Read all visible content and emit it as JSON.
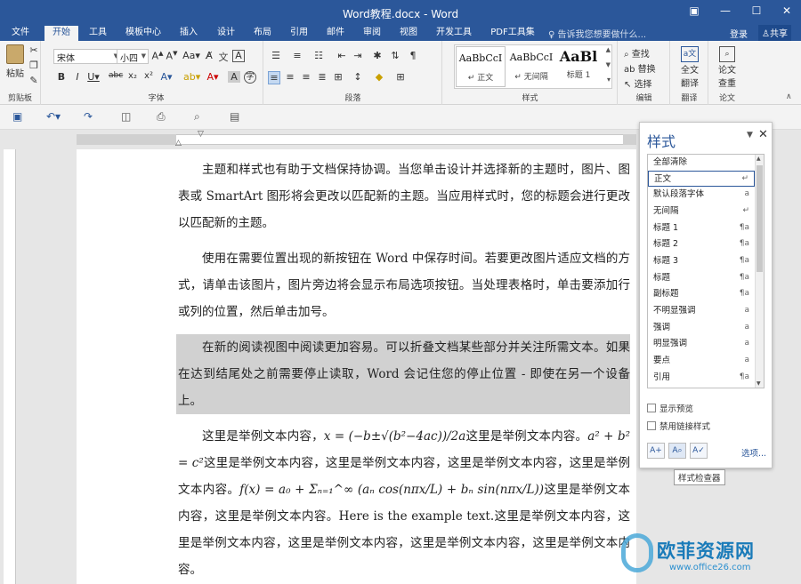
{
  "window": {
    "title": "Word教程.docx - Word",
    "controls": {
      "ribbon_display": "▣",
      "minimize": "—",
      "maximize": "☐",
      "close": "✕"
    }
  },
  "tabs": [
    "文件",
    "开始",
    "工具",
    "模板中心",
    "插入",
    "设计",
    "布局",
    "引用",
    "邮件",
    "审阅",
    "视图",
    "开发工具",
    "PDF工具集"
  ],
  "active_tab": "开始",
  "tellme": "告诉我您想要做什么...",
  "account": {
    "login": "登录",
    "share": "共享"
  },
  "ribbon": {
    "clipboard": {
      "label": "剪贴板",
      "paste": "粘贴"
    },
    "font": {
      "label": "字体",
      "font_name": "宋体",
      "font_size": "小四"
    },
    "paragraph": {
      "label": "段落"
    },
    "styles": {
      "label": "样式",
      "items": [
        {
          "preview": "AaBbCcI",
          "name": "↵ 正文"
        },
        {
          "preview": "AaBbCcI",
          "name": "↵ 无间隔"
        },
        {
          "preview": "AaBl",
          "name": "标题 1"
        }
      ]
    },
    "editing": {
      "label": "编辑",
      "find": "查找",
      "replace": "替换",
      "select": "选择"
    },
    "translate": {
      "label": "翻译",
      "full_text": "全文",
      "translate_btn": "翻译"
    },
    "paper": {
      "label": "论文",
      "check1": "论文",
      "check2": "查重"
    }
  },
  "document": {
    "paragraphs": [
      "主题和样式也有助于文档保持协调。当您单击设计并选择新的主题时，图片、图表或 SmartArt 图形将会更改以匹配新的主题。当应用样式时，您的标题会进行更改以匹配新的主题。",
      "使用在需要位置出现的新按钮在 Word 中保存时间。若要更改图片适应文档的方式，请单击该图片，图片旁边将会显示布局选项按钮。当处理表格时，单击要添加行或列的位置，然后单击加号。",
      "在新的阅读视图中阅读更加容易。可以折叠文档某些部分并关注所需文本。如果在达到结尾处之前需要停止读取，Word 会记住您的停止位置 - 即使在另一个设备上。"
    ],
    "formula_para": {
      "t1": "这里是举例文本内容，",
      "f1": "x = (−b±√(b²−4ac))/2a",
      "t2": "这里是举例文本内容。",
      "f2": "a² + b² = c²",
      "t3": "这里是举例文本内容，这里是举例文本内容，这里是举例文本内容，这里是举例文本内容。",
      "f3": "f(x) = a₀ + Σₙ₌₁^∞ (aₙ cos(nπx/L) + bₙ sin(nπx/L))",
      "t4": "这里是举例文本内容，这里是举例文本内容。Here is the example text.这里是举例文本内容，这里是举例文本内容，这里是举例文本内容，这里是举例文本内容，这里是举例文本内容。"
    }
  },
  "styles_pane": {
    "title": "样式",
    "items": [
      {
        "name": "全部清除",
        "symbol": ""
      },
      {
        "name": "正文",
        "symbol": "↵"
      },
      {
        "name": "默认段落字体",
        "symbol": "a"
      },
      {
        "name": "无间隔",
        "symbol": "↵"
      },
      {
        "name": "标题 1",
        "symbol": "¶a"
      },
      {
        "name": "标题 2",
        "symbol": "¶a"
      },
      {
        "name": "标题 3",
        "symbol": "¶a"
      },
      {
        "name": "标题",
        "symbol": "¶a"
      },
      {
        "name": "副标题",
        "symbol": "¶a"
      },
      {
        "name": "不明显强调",
        "symbol": "a"
      },
      {
        "name": "强调",
        "symbol": "a"
      },
      {
        "name": "明显强调",
        "symbol": "a"
      },
      {
        "name": "要点",
        "symbol": "a"
      },
      {
        "name": "引用",
        "symbol": "¶a"
      }
    ],
    "selected": "正文",
    "show_preview": "显示预览",
    "disable_linked": "禁用链接样式",
    "options": "选项..."
  },
  "tooltip": "样式检查器",
  "watermark": {
    "text": "欧菲资源网",
    "url": "www.office26.com"
  },
  "colors": {
    "brand": "#2b579a",
    "highlight": "#d1d1d1"
  }
}
